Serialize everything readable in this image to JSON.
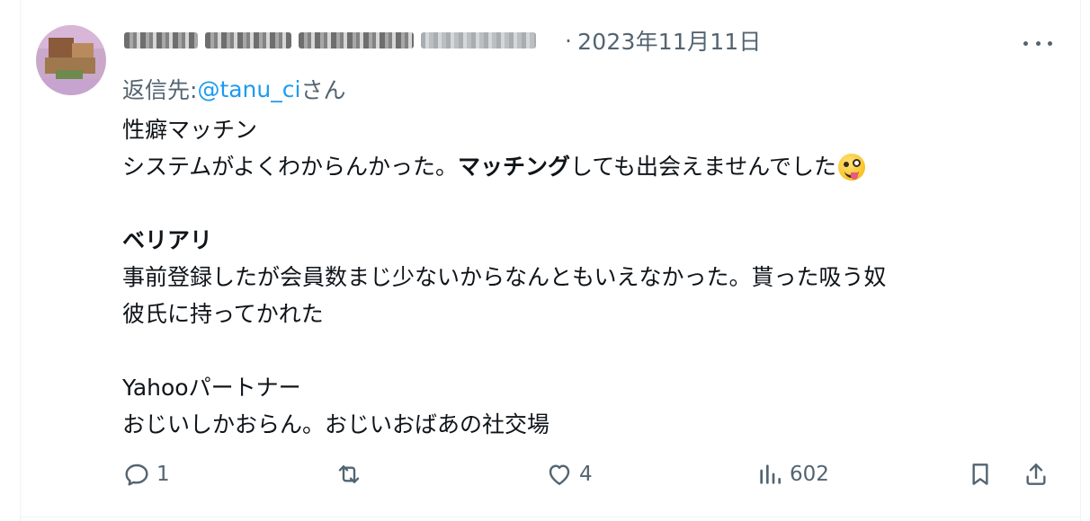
{
  "tweet": {
    "date": "2023年11月11日",
    "reply_prefix": "返信先: ",
    "reply_handle": "@tanu_ci",
    "reply_suffix": "さん",
    "lines": {
      "l1": "性癖マッチン",
      "l2a": "システムがよくわからんかった。",
      "l2b": "マッチング",
      "l2c": "しても出会えませんでした",
      "l3": "ベリアリ",
      "l4": "事前登録したが会員数まじ少ないからなんともいえなかった。貰った吸う奴",
      "l5": "彼氏に持ってかれた",
      "l6": "Yahooパートナー",
      "l7": "おじいしかおらん。おじいおばあの社交場"
    },
    "emoji": "zany-face-emoji"
  },
  "actions": {
    "reply_count": "1",
    "retweet_count": "",
    "like_count": "4",
    "views_count": "602"
  },
  "icons": {
    "more": "more-horizontal-icon",
    "reply": "reply-icon",
    "retweet": "retweet-icon",
    "like": "heart-icon",
    "views": "analytics-icon",
    "bookmark": "bookmark-icon",
    "share": "share-icon"
  },
  "colors": {
    "text": "#0f1419",
    "secondary": "#536471",
    "link": "#1d9bf0"
  }
}
